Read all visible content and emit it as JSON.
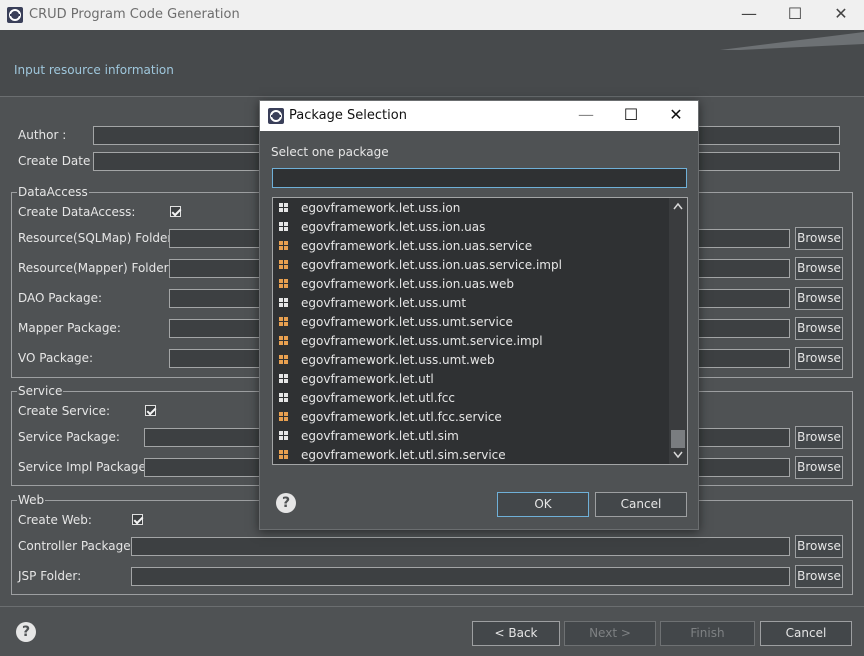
{
  "window": {
    "title": "CRUD Program Code Generation",
    "subtitle": "Input resource information"
  },
  "form": {
    "author_label": "Author :",
    "create_date_label": "Create Date :",
    "data_access": {
      "legend": "DataAccess",
      "create_label": "Create DataAccess:",
      "create_checked": true,
      "sqlmap_label": "Resource(SQLMap) Folder:",
      "mapper_label": "Resource(Mapper) Folder:",
      "dao_label": "DAO Package:",
      "mapper_pkg_label": "Mapper Package:",
      "vo_label": "VO Package:"
    },
    "service": {
      "legend": "Service",
      "create_label": "Create Service:",
      "create_checked": true,
      "service_pkg_label": "Service Package:",
      "service_impl_label": "Service Impl Package:"
    },
    "web": {
      "legend": "Web",
      "create_label": "Create Web:",
      "create_checked": true,
      "controller_label": "Controller Package:",
      "jsp_label": "JSP Folder:"
    },
    "browse_label": "Browse"
  },
  "footer": {
    "back": "< Back",
    "next": "Next >",
    "finish": "Finish",
    "cancel": "Cancel"
  },
  "dialog": {
    "title": "Package Selection",
    "prompt": "Select one package",
    "filter_value": "",
    "packages": [
      {
        "name": "egovframework.let.uss.ion",
        "icon": "package-icon-empty"
      },
      {
        "name": "egovframework.let.uss.ion.uas",
        "icon": "package-icon-empty"
      },
      {
        "name": "egovframework.let.uss.ion.uas.service",
        "icon": "package-icon"
      },
      {
        "name": "egovframework.let.uss.ion.uas.service.impl",
        "icon": "package-icon"
      },
      {
        "name": "egovframework.let.uss.ion.uas.web",
        "icon": "package-icon"
      },
      {
        "name": "egovframework.let.uss.umt",
        "icon": "package-icon-empty"
      },
      {
        "name": "egovframework.let.uss.umt.service",
        "icon": "package-icon"
      },
      {
        "name": "egovframework.let.uss.umt.service.impl",
        "icon": "package-icon"
      },
      {
        "name": "egovframework.let.uss.umt.web",
        "icon": "package-icon"
      },
      {
        "name": "egovframework.let.utl",
        "icon": "package-icon-empty"
      },
      {
        "name": "egovframework.let.utl.fcc",
        "icon": "package-icon-empty"
      },
      {
        "name": "egovframework.let.utl.fcc.service",
        "icon": "package-icon"
      },
      {
        "name": "egovframework.let.utl.sim",
        "icon": "package-icon-empty"
      },
      {
        "name": "egovframework.let.utl.sim.service",
        "icon": "package-icon"
      }
    ],
    "ok": "OK",
    "cancel": "Cancel"
  },
  "colors": {
    "background": "#4f5254",
    "package_fill": "#e8a050",
    "empty_package": "#e6e6e6",
    "accent_border": "#6fb0d8"
  }
}
